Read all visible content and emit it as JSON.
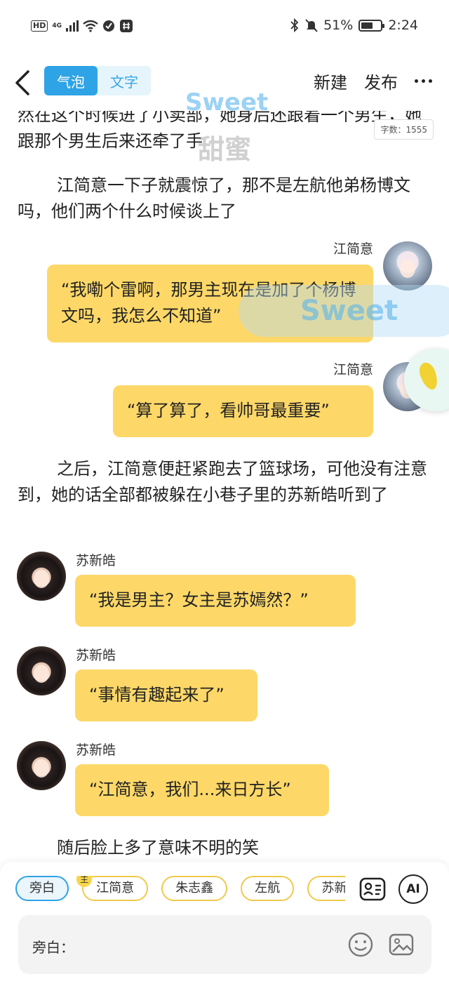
{
  "status_bar": {
    "hd": "HD",
    "network": "4G",
    "battery": "51%",
    "battery_level": 0.51,
    "time": "2:24"
  },
  "header": {
    "tab_bubble": "气泡",
    "tab_text": "文字",
    "new_label": "新建",
    "publish_label": "发布"
  },
  "watermark": {
    "text": "Sweet",
    "subtitle": "甜蜜"
  },
  "word_count": "字数：1555",
  "story": {
    "para_top": "然在这个时候进了小卖部，她身后还跟着一个男生，她跟那个男生后来还牵了手",
    "para_1": "江简意一下子就震惊了，那不是左航他弟杨博文吗，他们两个什么时候谈上了",
    "msg_1": {
      "speaker": "江简意",
      "text": "“我嘞个雷啊，那男主现在是加了个杨博文吗，我怎么不知道”"
    },
    "msg_2": {
      "speaker": "江简意",
      "text": "“算了算了，看帅哥最重要”"
    },
    "para_2": "之后，江简意便赶紧跑去了篮球场，可他没有注意到，她的话全部都被躲在小巷子里的苏新皓听到了",
    "msg_3": {
      "speaker": "苏新皓",
      "text": "“我是男主？女主是苏嫣然？”"
    },
    "msg_4": {
      "speaker": "苏新皓",
      "text": "“事情有趣起来了”"
    },
    "msg_5": {
      "speaker": "苏新皓",
      "text": "“江简意，我们...来日方长”"
    },
    "para_3": "随后脸上多了意味不明的笑"
  },
  "bottom": {
    "chips": [
      "旁白",
      "江简意",
      "朱志鑫",
      "左航",
      "苏新皓"
    ],
    "main_badge": "主",
    "ai_label": "AI",
    "input_placeholder": "旁白："
  },
  "icons": {
    "back": "chevron-left-icon",
    "more": "more-dots-icon",
    "contact_card": "contact-card-icon",
    "emoji": "smile-icon",
    "image": "image-icon"
  },
  "colors": {
    "accent": "#2ea3e6",
    "bubble": "#fdd868",
    "chip_border": "#f2c94c"
  }
}
